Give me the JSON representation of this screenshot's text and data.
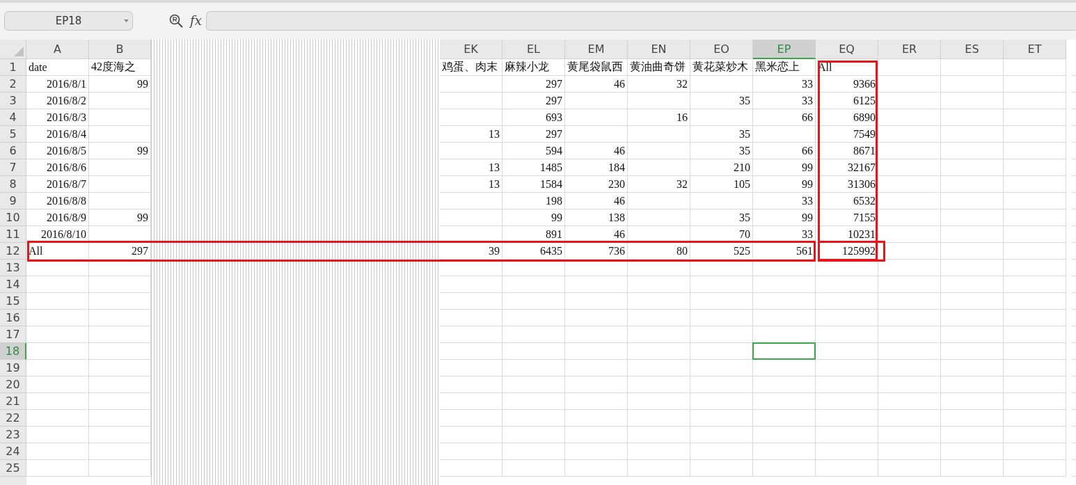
{
  "name_box": {
    "value": "EP18"
  },
  "formula_bar": {
    "fx": "fx"
  },
  "columns": [
    {
      "kind": "normal",
      "label": "A",
      "selected": false,
      "highlighted": false
    },
    {
      "kind": "normal",
      "label": "B",
      "selected": false,
      "highlighted": false
    },
    {
      "kind": "collapsed"
    },
    {
      "kind": "normal",
      "label": "EK",
      "selected": false,
      "highlighted": false
    },
    {
      "kind": "normal",
      "label": "EL",
      "selected": false,
      "highlighted": false
    },
    {
      "kind": "normal",
      "label": "EM",
      "selected": false,
      "highlighted": false
    },
    {
      "kind": "normal",
      "label": "EN",
      "selected": false,
      "highlighted": false
    },
    {
      "kind": "normal",
      "label": "EO",
      "selected": false,
      "highlighted": false
    },
    {
      "kind": "normal",
      "label": "EP",
      "selected": true,
      "highlighted": false
    },
    {
      "kind": "normal",
      "label": "EQ",
      "selected": false,
      "highlighted": true
    },
    {
      "kind": "normal",
      "label": "ER",
      "selected": false,
      "highlighted": false
    },
    {
      "kind": "normal",
      "label": "ES",
      "selected": false,
      "highlighted": false
    },
    {
      "kind": "normal",
      "label": "ET",
      "selected": false,
      "highlighted": false
    }
  ],
  "rows": [
    {
      "number": "1",
      "kind": "header",
      "selected": false,
      "highlighted": false,
      "cells": [
        "date",
        "42度海之",
        "鸡蛋、肉末",
        "麻辣小龙",
        "黄尾袋鼠西",
        "黄油曲奇饼",
        "黄花菜炒木",
        "黑米恋上",
        "All"
      ]
    },
    {
      "number": "2",
      "kind": "data",
      "selected": false,
      "highlighted": false,
      "cells": [
        "2016/8/1",
        "99",
        null,
        "297",
        "46",
        "32",
        null,
        "33",
        "9366"
      ]
    },
    {
      "number": "3",
      "kind": "data",
      "selected": false,
      "highlighted": false,
      "cells": [
        "2016/8/2",
        null,
        null,
        "297",
        null,
        null,
        "35",
        "33",
        "6125"
      ]
    },
    {
      "number": "4",
      "kind": "data",
      "selected": false,
      "highlighted": false,
      "cells": [
        "2016/8/3",
        null,
        null,
        "693",
        null,
        "16",
        null,
        "66",
        "6890"
      ]
    },
    {
      "number": "5",
      "kind": "data",
      "selected": false,
      "highlighted": false,
      "cells": [
        "2016/8/4",
        null,
        "13",
        "297",
        null,
        null,
        "35",
        null,
        "7549"
      ]
    },
    {
      "number": "6",
      "kind": "data",
      "selected": false,
      "highlighted": false,
      "cells": [
        "2016/8/5",
        "99",
        null,
        "594",
        "46",
        null,
        "35",
        "66",
        "8671"
      ]
    },
    {
      "number": "7",
      "kind": "data",
      "selected": false,
      "highlighted": false,
      "cells": [
        "2016/8/6",
        null,
        "13",
        "1485",
        "184",
        null,
        "210",
        "99",
        "32167"
      ]
    },
    {
      "number": "8",
      "kind": "data",
      "selected": false,
      "highlighted": false,
      "cells": [
        "2016/8/7",
        null,
        "13",
        "1584",
        "230",
        "32",
        "105",
        "99",
        "31306"
      ]
    },
    {
      "number": "9",
      "kind": "data",
      "selected": false,
      "highlighted": false,
      "cells": [
        "2016/8/8",
        null,
        null,
        "198",
        "46",
        null,
        null,
        "33",
        "6532"
      ]
    },
    {
      "number": "10",
      "kind": "data",
      "selected": false,
      "highlighted": false,
      "cells": [
        "2016/8/9",
        "99",
        null,
        "99",
        "138",
        null,
        "35",
        "99",
        "7155"
      ]
    },
    {
      "number": "11",
      "kind": "data",
      "selected": false,
      "highlighted": false,
      "cells": [
        "2016/8/10",
        null,
        null,
        "891",
        "46",
        null,
        "70",
        "33",
        "10231"
      ]
    },
    {
      "number": "12",
      "kind": "total",
      "selected": false,
      "highlighted": true,
      "cells": [
        "All",
        "297",
        "39",
        "6435",
        "736",
        "80",
        "525",
        "561",
        "125992"
      ]
    },
    {
      "number": "13",
      "kind": "data",
      "selected": false,
      "highlighted": false
    },
    {
      "number": "14",
      "kind": "data",
      "selected": false,
      "highlighted": false
    },
    {
      "number": "15",
      "kind": "data",
      "selected": false,
      "highlighted": false
    },
    {
      "number": "16",
      "kind": "data",
      "selected": false,
      "highlighted": false
    },
    {
      "number": "17",
      "kind": "data",
      "selected": false,
      "highlighted": false
    },
    {
      "number": "18",
      "kind": "data",
      "selected": true,
      "highlighted": false
    },
    {
      "number": "19",
      "kind": "data",
      "selected": false,
      "highlighted": false
    },
    {
      "number": "20",
      "kind": "data",
      "selected": false,
      "highlighted": false
    },
    {
      "number": "21",
      "kind": "data",
      "selected": false,
      "highlighted": false
    },
    {
      "number": "22",
      "kind": "data",
      "selected": false,
      "highlighted": false
    },
    {
      "number": "23",
      "kind": "data",
      "selected": false,
      "highlighted": false
    },
    {
      "number": "24",
      "kind": "data",
      "selected": false,
      "highlighted": false
    },
    {
      "number": "25",
      "kind": "data",
      "selected": false,
      "highlighted": false
    }
  ]
}
